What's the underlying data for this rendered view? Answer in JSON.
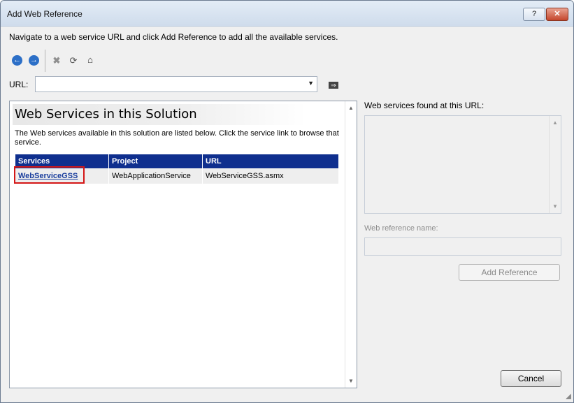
{
  "window": {
    "title": "Add Web Reference",
    "help_label": "?",
    "close_label": "✕"
  },
  "instruction": "Navigate to a web service URL and click Add Reference to add all the available services.",
  "toolbar": {
    "icons": [
      "back-icon",
      "forward-icon",
      "stop-icon",
      "refresh-icon",
      "home-icon"
    ]
  },
  "url": {
    "label": "URL:",
    "value": ""
  },
  "browser": {
    "heading": "Web Services in this Solution",
    "description": "The Web services available in this solution are listed below. Click the service link to browse that service.",
    "table": {
      "headers": [
        "Services",
        "Project",
        "URL"
      ],
      "rows": [
        {
          "service": "WebServiceGSS",
          "project": "WebApplicationService",
          "url": "WebServiceGSS.asmx"
        }
      ]
    }
  },
  "right_panel": {
    "found_label": "Web services found at this URL:",
    "refname_label": "Web reference name:",
    "add_reference_label": "Add Reference"
  },
  "cancel_label": "Cancel",
  "colors": {
    "table_header": "#0f2f8e",
    "highlight": "#d41616",
    "link": "#1a3e9d"
  }
}
